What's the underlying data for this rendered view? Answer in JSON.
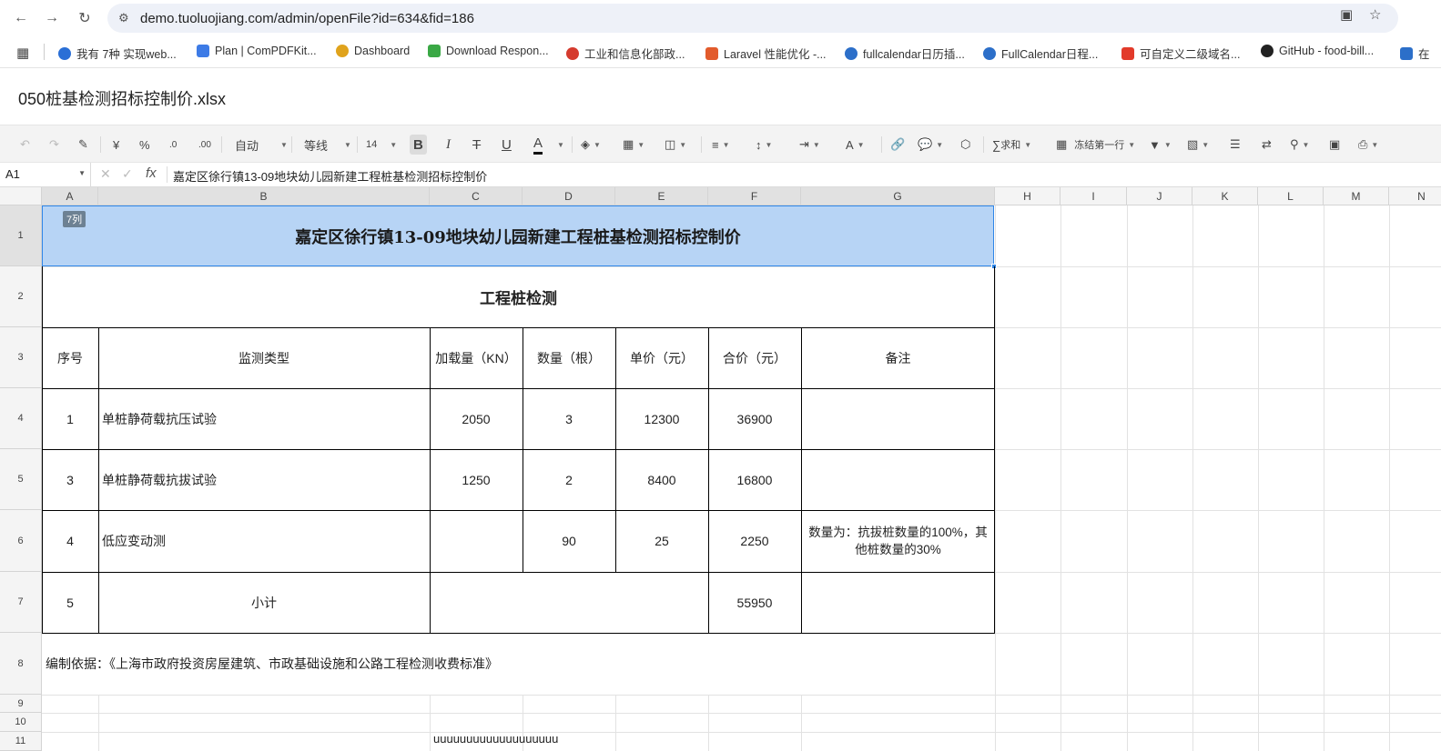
{
  "browser": {
    "url": "demo.tuoluojiang.com/admin/openFile?id=634&fid=186",
    "bookmarks": [
      {
        "label": "我有 7种 实现web...",
        "color": "#2a6fd6"
      },
      {
        "label": "Plan | ComPDFKit...",
        "color": "#3d7be6"
      },
      {
        "label": "Dashboard",
        "color": "#e0a31c"
      },
      {
        "label": "Download Respon...",
        "color": "#3aa845"
      },
      {
        "label": "工业和信息化部政...",
        "color": "#d53b2e"
      },
      {
        "label": "Laravel 性能优化 -...",
        "color": "#e25b2c"
      },
      {
        "label": "fullcalendar日历插...",
        "color": "#2c6fc9"
      },
      {
        "label": "FullCalendar日程...",
        "color": "#2c6fc9"
      },
      {
        "label": "可自定义二级域名...",
        "color": "#e23a2a"
      },
      {
        "label": "GitHub - food-bill...",
        "color": "#222222"
      },
      {
        "label": "在",
        "color": "#2c6fc9"
      }
    ]
  },
  "file": {
    "title": "050桩基检测招标控制价.xlsx"
  },
  "toolbar": {
    "number_format": "自动",
    "font_name": "等线",
    "font_size": "14",
    "currency": "¥",
    "percent": "%",
    "dec_inc": ".0",
    "dec_dec": ".00",
    "bold": "B",
    "italic": "I",
    "strike": "T",
    "underline": "U",
    "font_color": "A",
    "sum": "求和",
    "freeze": "冻结第一行"
  },
  "formula_bar": {
    "cell_ref": "A1",
    "fx": "fx",
    "content": "嘉定区徐行镇13-09地块幼儿园新建工程桩基检测招标控制价"
  },
  "grid": {
    "columns": [
      "A",
      "B",
      "C",
      "D",
      "E",
      "F",
      "G",
      "H",
      "I",
      "J",
      "K",
      "L",
      "M",
      "N"
    ],
    "rows": [
      "1",
      "2",
      "3",
      "4",
      "5",
      "6",
      "7",
      "8",
      "9",
      "10",
      "11"
    ],
    "col_badge": "7列"
  },
  "sheet": {
    "title": "嘉定区徐行镇13-09地块幼儿园新建工程桩基检测招标控制价",
    "subtitle": "工程桩检测",
    "headers": [
      "序号",
      "监测类型",
      "加载量（KN）",
      "数量（根）",
      "单价（元）",
      "合价（元）",
      "备注"
    ],
    "rows": [
      {
        "no": "1",
        "type": "单桩静荷载抗压试验",
        "load": "2050",
        "qty": "3",
        "price": "12300",
        "total": "36900",
        "note": ""
      },
      {
        "no": "3",
        "type": "单桩静荷载抗拔试验",
        "load": "1250",
        "qty": "2",
        "price": "8400",
        "total": "16800",
        "note": ""
      },
      {
        "no": "4",
        "type": "低应变动测",
        "load": "",
        "qty": "90",
        "price": "25",
        "total": "2250",
        "note": "数量为：抗拔桩数量的100%，其他桩数量的30%"
      }
    ],
    "subtotal": {
      "no": "5",
      "label": "小计",
      "total": "55950"
    },
    "basis": "编制依据：《上海市政府投资房屋建筑、市政基础设施和公路工程检测收费标准》",
    "row11_c": "uuuuuuuuuuuuuuuuuuu"
  }
}
